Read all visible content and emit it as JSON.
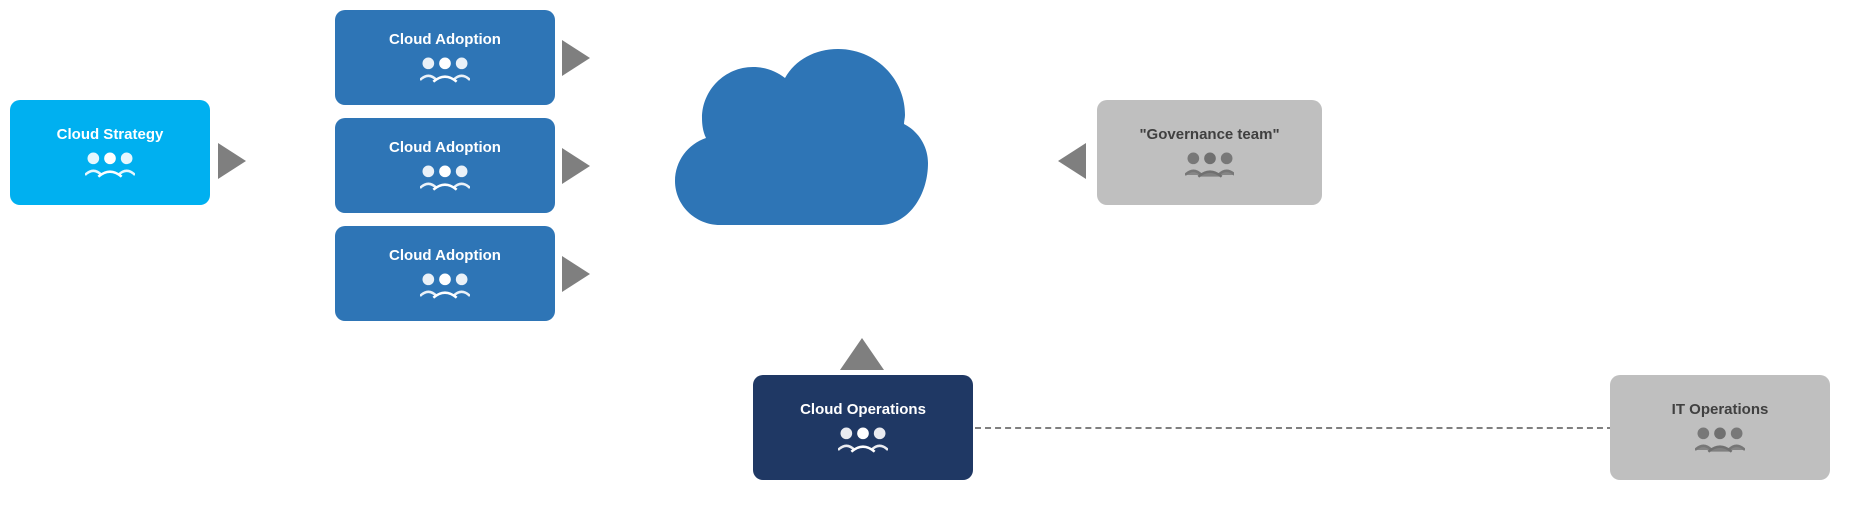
{
  "boxes": {
    "cloud_strategy": {
      "label": "Cloud Strategy",
      "color": "cyan"
    },
    "cloud_adoption_1": {
      "label": "Cloud Adoption",
      "color": "blue"
    },
    "cloud_adoption_2": {
      "label": "Cloud Adoption",
      "color": "blue"
    },
    "cloud_adoption_3": {
      "label": "Cloud Adoption",
      "color": "blue"
    },
    "cloud_operations": {
      "label": "Cloud Operations",
      "color": "dark-navy"
    },
    "governance_team": {
      "label": "\"Governance team\"",
      "color": "gray"
    },
    "it_operations": {
      "label": "IT Operations",
      "color": "gray"
    }
  },
  "arrows": {
    "strategy_to_adoption": "right",
    "adoption1_to_cloud": "right",
    "adoption2_to_cloud": "right",
    "adoption3_to_cloud": "right",
    "operations_to_cloud": "up",
    "governance_from_cloud": "left"
  },
  "icon": {
    "people": "👥"
  }
}
